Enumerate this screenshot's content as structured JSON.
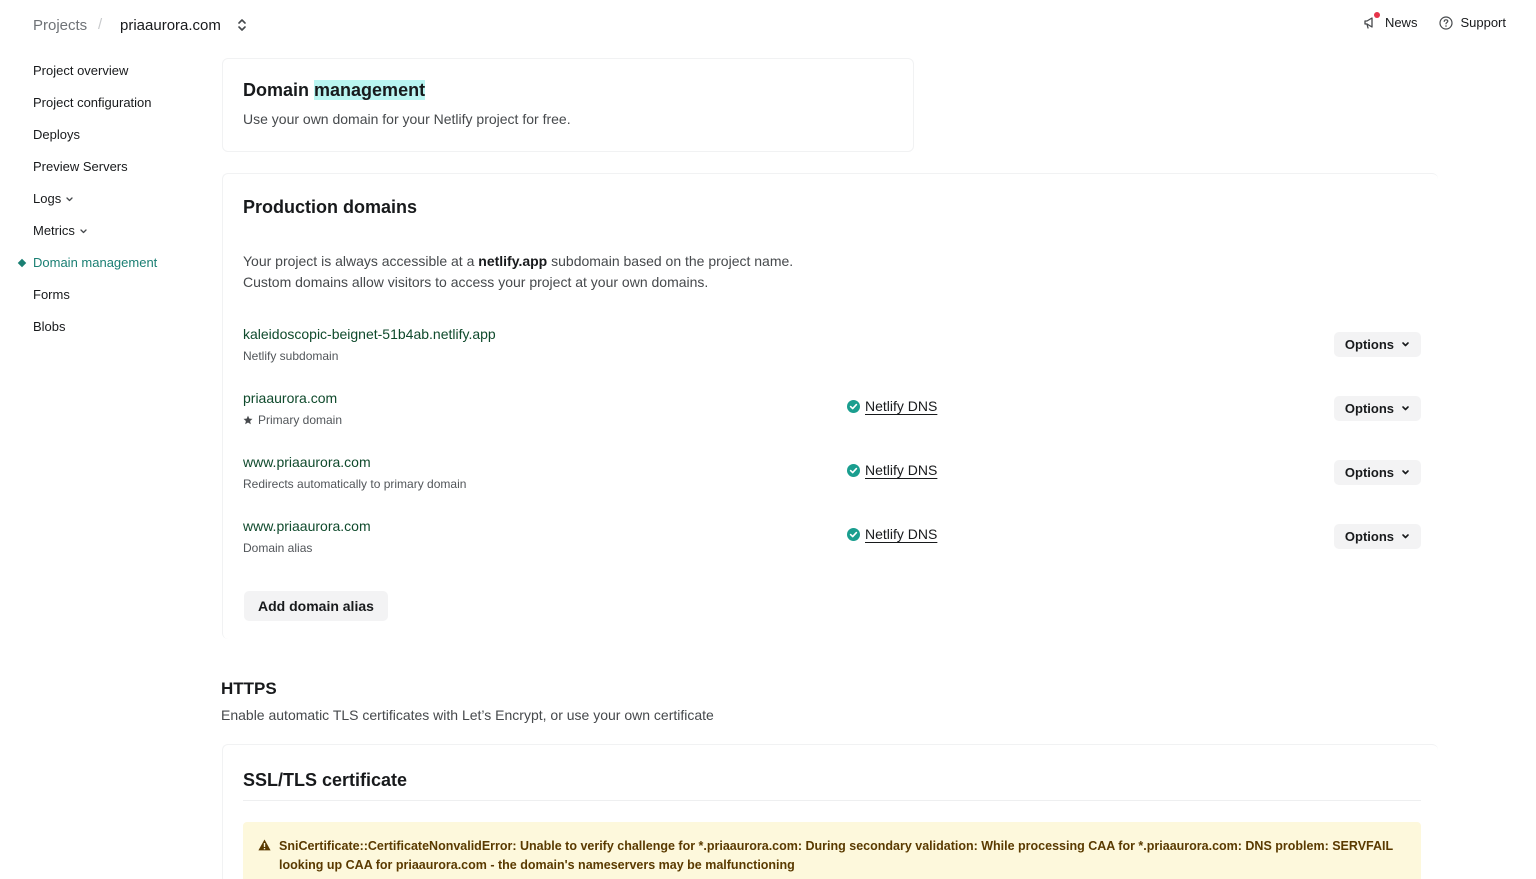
{
  "breadcrumb": {
    "projects": "Projects",
    "separator": "/",
    "site": "priaaurora.com"
  },
  "topnav": {
    "news": "News",
    "support": "Support"
  },
  "sidebar": {
    "items": [
      {
        "label": "Project overview"
      },
      {
        "label": "Project configuration"
      },
      {
        "label": "Deploys"
      },
      {
        "label": "Preview Servers"
      },
      {
        "label": "Logs"
      },
      {
        "label": "Metrics"
      },
      {
        "label": "Domain management"
      },
      {
        "label": "Forms"
      },
      {
        "label": "Blobs"
      }
    ],
    "active": "Domain management"
  },
  "header": {
    "title_part1": "Domain",
    "title_highlight": "management",
    "subtitle": "Use your own domain for your Netlify project for free."
  },
  "production": {
    "title": "Production domains",
    "desc_line1_pre": "Your project is always accessible at a ",
    "desc_line1_bold": "netlify.app",
    "desc_line1_post": " subdomain based on the project name.",
    "desc_line2": "Custom domains allow visitors to access your project at your own domains.",
    "domains": [
      {
        "name": "kaleidoscopic-beignet-51b4ab.netlify.app",
        "meta": "Netlify subdomain",
        "dns": "",
        "options": "Options"
      },
      {
        "name": "priaaurora.com",
        "meta": "Primary domain",
        "dns": "Netlify DNS",
        "options": "Options"
      },
      {
        "name": "www.priaaurora.com",
        "meta": "Redirects automatically to primary domain",
        "dns": "Netlify DNS",
        "options": "Options"
      },
      {
        "name": "www.priaaurora.com",
        "meta": "Domain alias",
        "dns": "Netlify DNS",
        "options": "Options"
      }
    ],
    "add_alias": "Add domain alias"
  },
  "https": {
    "title": "HTTPS",
    "subtitle": "Enable automatic TLS certificates with Let’s Encrypt, or use your own certificate"
  },
  "ssl": {
    "title": "SSL/TLS certificate",
    "error_line1": "SniCertificate::CertificateNonvalidError: Unable to verify challenge for *.priaaurora.com: During secondary validation: While processing CAA for *.priaaurora.com: DNS problem: SERVFAIL",
    "error_line2": "looking up CAA for priaaurora.com - the domain's nameservers may be malfunctioning"
  },
  "colors": {
    "accent": "#1a7f73",
    "highlight": "#b9f5f1",
    "dns_check": "#1a9e8f",
    "warning_bg": "#fdf8dc",
    "warning_text": "#5a3a00",
    "domain_link": "#0f4a2c"
  }
}
